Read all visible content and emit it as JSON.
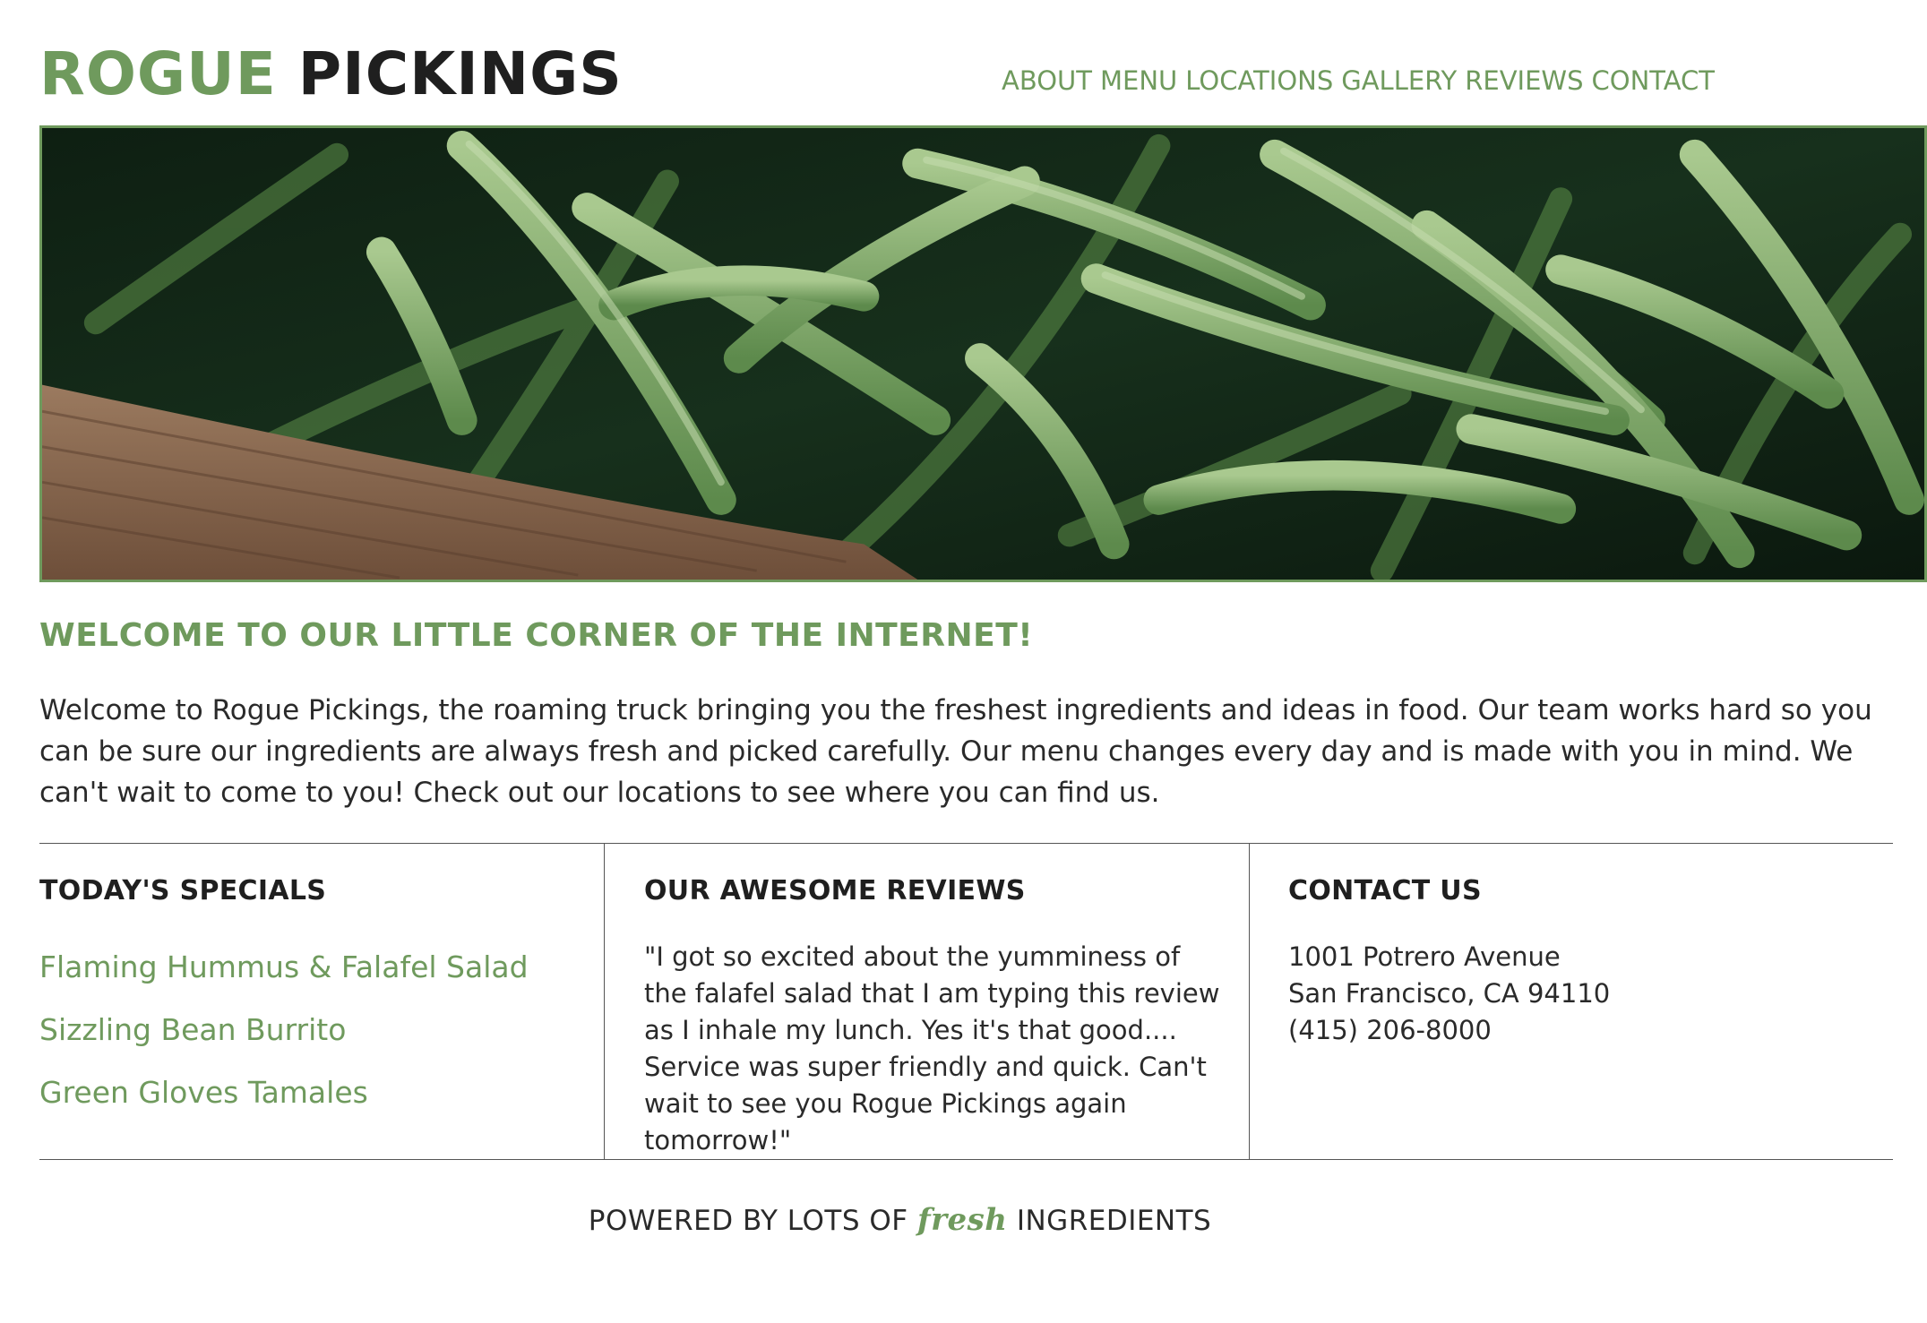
{
  "header": {
    "brand_first": "ROGUE",
    "brand_second": "PICKINGS",
    "nav": [
      "ABOUT",
      "MENU",
      "LOCATIONS",
      "GALLERY",
      "REVIEWS",
      "CONTACT"
    ]
  },
  "hero": {
    "image_subject": "green beans in a wooden crate"
  },
  "welcome": {
    "title": "WELCOME TO OUR LITTLE CORNER OF THE INTERNET!",
    "text": "Welcome to Rogue Pickings, the roaming truck bringing you the freshest ingredients and ideas in food. Our team works hard so you can be sure our ingredients are always fresh and picked carefully. Our menu changes every day and is made with you in mind. We can't wait to come to you! Check out our locations to see where you can find us."
  },
  "specials": {
    "title": "TODAY'S SPECIALS",
    "items": [
      "Flaming Hummus & Falafel Salad",
      "Sizzling Bean Burrito",
      "Green Gloves Tamales"
    ]
  },
  "reviews": {
    "title": "OUR AWESOME REVIEWS",
    "quote": "\"I got so excited about the yumminess of the falafel salad that I am typing this review as I inhale my lunch. Yes it's that good.... Service was super friendly and quick. Can't wait to see you Rogue Pickings again tomorrow!\""
  },
  "contact": {
    "title": "CONTACT US",
    "street": "1001 Potrero Avenue",
    "city": "San Francisco, CA 94110",
    "phone": "(415) 206-8000"
  },
  "footer": {
    "before": "POWERED BY LOTS OF",
    "highlight": "fresh",
    "after": "INGREDIENTS"
  },
  "colors": {
    "accent_green": "#6f9a5d",
    "text_dark": "#1f1f1f"
  }
}
